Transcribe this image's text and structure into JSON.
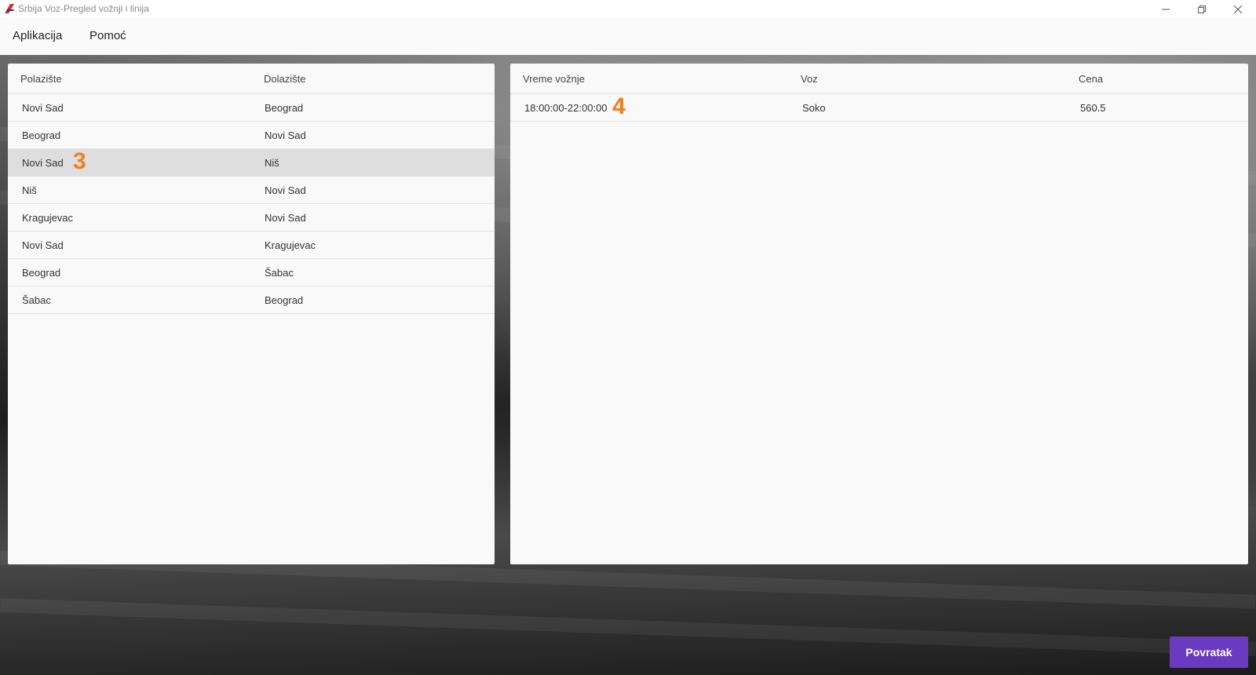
{
  "window": {
    "title": "Srbija Voz-Pregled vožnji i linija",
    "icon": "train-logo-icon"
  },
  "menu": {
    "items": [
      "Aplikacija",
      "Pomoć"
    ]
  },
  "routes_table": {
    "columns": [
      "Polazište",
      "Dolazište"
    ],
    "rows": [
      {
        "from": "Novi Sad",
        "to": "Beograd"
      },
      {
        "from": "Beograd",
        "to": "Novi Sad"
      },
      {
        "from": "Novi Sad",
        "to": "Niš"
      },
      {
        "from": "Niš",
        "to": "Novi Sad"
      },
      {
        "from": "Kragujevac",
        "to": "Novi Sad"
      },
      {
        "from": "Novi Sad",
        "to": "Kragujevac"
      },
      {
        "from": "Beograd",
        "to": "Šabac"
      },
      {
        "from": "Šabac",
        "to": "Beograd"
      }
    ],
    "selected_row": 2
  },
  "rides_table": {
    "columns": [
      "Vreme vožnje",
      "Voz",
      "Cena"
    ],
    "rows": [
      {
        "time": "18:00:00-22:00:00",
        "train": "Soko",
        "price": "560.5"
      }
    ]
  },
  "annotations": {
    "left_marker": "3",
    "right_marker": "4"
  },
  "buttons": {
    "back_label": "Povratak"
  },
  "colors": {
    "accent": "#6a3bc0",
    "marker": "#f07f22",
    "selected_row": "#dedede"
  }
}
